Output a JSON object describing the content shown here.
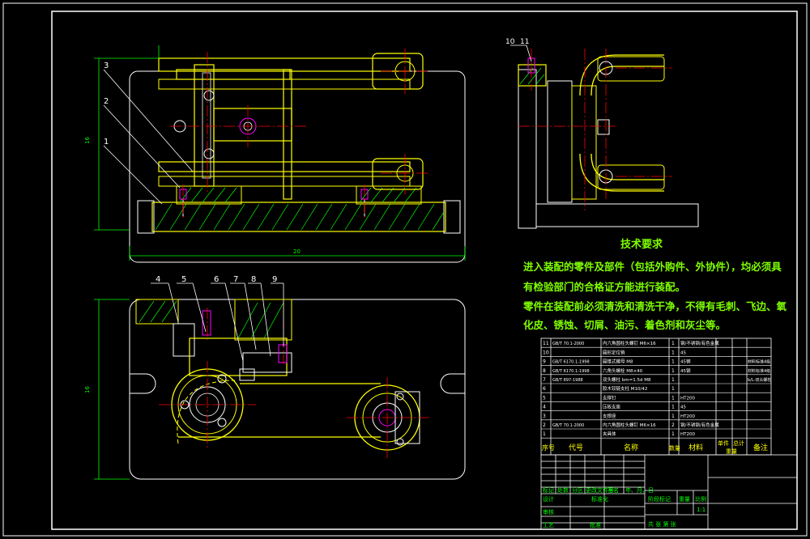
{
  "colors": {
    "background": "#000000",
    "frame": "#ffffff",
    "part": "#ffff00",
    "hatch": "#00ff00",
    "centerline": "#ff0000",
    "dimension": "#00ff00",
    "accent": "#ff00ff",
    "text": "#7fff00",
    "cyan": "#00ffff"
  },
  "balloons": [
    "1",
    "2",
    "3",
    "4",
    "5",
    "6",
    "7",
    "8",
    "9",
    "10",
    "11"
  ],
  "dimensions": {
    "height_front": "16",
    "width_front": "20",
    "height_top": "16"
  },
  "tech_requirements": {
    "title": "技术要求",
    "line1": "进入装配的零件及部件（包括外购件、外协件），均必须具",
    "line2": "有检验部门的合格证方能进行装配。",
    "line3": "零件在装配前必须清洗和清洗干净，不得有毛刺、飞边、氧",
    "line4": "化皮、锈蚀、切屑、油污、着色剂和灰尘等。"
  },
  "bom_header": {
    "seq": "序号",
    "code": "代号",
    "name": "名称",
    "qty": "数量",
    "material": "材料",
    "single": "单件",
    "total": "总计",
    "weight": "重量",
    "remark": "备注"
  },
  "bom_rows": [
    {
      "seq": "11",
      "code": "GB/T 70.1-2000",
      "name": "内六角圆柱头螺钉 M6×16",
      "qty": "1",
      "material": "钢/不锈钢/有色金属",
      "remark": ""
    },
    {
      "seq": "10",
      "code": "",
      "name": "圆形定位销",
      "qty": "1",
      "material": "45",
      "remark": ""
    },
    {
      "seq": "9",
      "code": "GB/T 6170.1-1998",
      "name": "圆锥式螺母 M8",
      "qty": "1",
      "material": "45钢",
      "remark": "材料标准4级"
    },
    {
      "seq": "8",
      "code": "GB/T 6170.1-1998",
      "name": "六角头螺栓 M8×40",
      "qty": "1",
      "material": "45钢",
      "remark": "材料标准4级"
    },
    {
      "seq": "7",
      "code": "GB/T 897-1988",
      "name": "双头螺柱 bm=1.5d M8",
      "qty": "1",
      "material": "",
      "remark": "b/L-双头螺柱"
    },
    {
      "seq": "6",
      "code": "",
      "name": "胶木铰链支柱 M10/42",
      "qty": "1",
      "material": "",
      "remark": ""
    },
    {
      "seq": "5",
      "code": "",
      "name": "支撑钉",
      "qty": "1",
      "material": "HT200",
      "remark": ""
    },
    {
      "seq": "4",
      "code": "",
      "name": "压板支座",
      "qty": "1",
      "material": "45",
      "remark": ""
    },
    {
      "seq": "3",
      "code": "",
      "name": "支撑座",
      "qty": "1",
      "material": "HT200",
      "remark": ""
    },
    {
      "seq": "2",
      "code": "GB/T 70.1-2000",
      "name": "内六角圆柱头螺钉 M6×16",
      "qty": "2",
      "material": "钢/不锈钢/有色金属",
      "remark": ""
    },
    {
      "seq": "1",
      "code": "",
      "name": "夹具体",
      "qty": "1",
      "material": "HT200",
      "remark": ""
    }
  ],
  "title_block": {
    "mark": "标记",
    "count": "处数",
    "zone": "分区",
    "change_doc": "更改文件号",
    "sign": "签名",
    "date": "年、月、日",
    "design": "设计",
    "standard": "标准化",
    "stage_mark": "阶段标记",
    "weight": "重量",
    "scale": "比例",
    "scale_value": "1:1",
    "review": "审核",
    "process": "工艺",
    "approve": "批准",
    "sheet_info": "共   张   第   张"
  }
}
